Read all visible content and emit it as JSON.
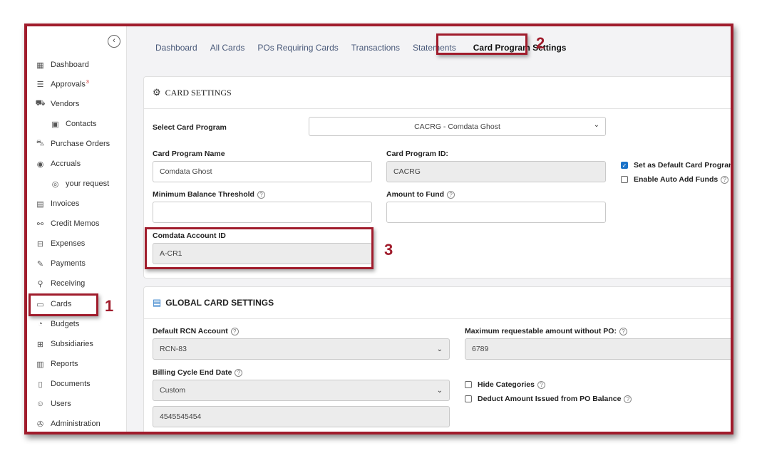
{
  "sidebar": {
    "collapse_glyph": "‹",
    "items": [
      {
        "label": "Dashboard",
        "icon": "dashboard-icon",
        "glyph": "▦"
      },
      {
        "label": "Approvals",
        "badge": "3",
        "icon": "list-check-icon",
        "glyph": "☰"
      },
      {
        "label": "Vendors",
        "icon": "vendors-icon",
        "glyph": "⛟"
      },
      {
        "label": "Contacts",
        "icon": "contact-book-icon",
        "glyph": "▣"
      },
      {
        "label": "Purchase Orders",
        "icon": "cart-icon",
        "glyph": "⛍"
      },
      {
        "label": "Accruals",
        "icon": "accrual-icon",
        "glyph": "◉"
      },
      {
        "label": "your request",
        "icon": "request-icon",
        "glyph": "◎"
      },
      {
        "label": "Invoices",
        "icon": "invoice-icon",
        "glyph": "▤"
      },
      {
        "label": "Credit Memos",
        "icon": "credit-memo-icon",
        "glyph": "⚯"
      },
      {
        "label": "Expenses",
        "icon": "expense-icon",
        "glyph": "⊟"
      },
      {
        "label": "Payments",
        "icon": "payment-icon",
        "glyph": "✎"
      },
      {
        "label": "Receiving",
        "icon": "receiving-icon",
        "glyph": "⚲"
      },
      {
        "label": "Cards",
        "icon": "cards-icon",
        "glyph": "▭"
      },
      {
        "label": "Budgets",
        "icon": "budget-icon",
        "glyph": "◔"
      },
      {
        "label": "Subsidiaries",
        "icon": "subsidiary-icon",
        "glyph": "⊞"
      },
      {
        "label": "Reports",
        "icon": "report-icon",
        "glyph": "▥"
      },
      {
        "label": "Documents",
        "icon": "document-icon",
        "glyph": "▯"
      },
      {
        "label": "Users",
        "icon": "user-icon",
        "glyph": "☺"
      },
      {
        "label": "Administration",
        "icon": "wrench-icon",
        "glyph": "✇"
      }
    ]
  },
  "tabs": [
    "Dashboard",
    "All Cards",
    "POs Requiring Cards",
    "Transactions",
    "Statements",
    "Card Program Settings"
  ],
  "card_settings": {
    "title": "CARD SETTINGS",
    "select_program_label": "Select Card Program",
    "select_program_value": "CACRG - Comdata Ghost",
    "program_name_label": "Card Program Name",
    "program_name_value": "Comdata Ghost",
    "program_id_label": "Card Program ID:",
    "program_id_value": "CACRG",
    "default_program_label": "Set as Default Card Program",
    "auto_add_funds_label": "Enable Auto Add Funds",
    "min_balance_label": "Minimum Balance Threshold",
    "min_balance_value": "",
    "amount_to_fund_label": "Amount to Fund",
    "amount_to_fund_value": "",
    "account_id_label": "Comdata Account ID",
    "account_id_value": "A-CR1"
  },
  "global_settings": {
    "title": "GLOBAL CARD SETTINGS",
    "rcn_label": "Default RCN Account",
    "rcn_value": "RCN-83",
    "max_amount_label": "Maximum requestable amount without PO:",
    "max_amount_value": "6789",
    "billing_label": "Billing Cycle End Date",
    "billing_value": "Custom",
    "billing_custom_value": "4545545454",
    "hide_categories_label": "Hide Categories",
    "deduct_label": "Deduct Amount Issued from PO Balance"
  },
  "help_glyph": "?",
  "check_glyph": "✓",
  "chevron_glyph": "⌄",
  "annotations": [
    "1",
    "2",
    "3"
  ],
  "colors": {
    "accent": "#a01c2c",
    "checkbox": "#1a73c9",
    "tab": "#4a5a7a"
  }
}
